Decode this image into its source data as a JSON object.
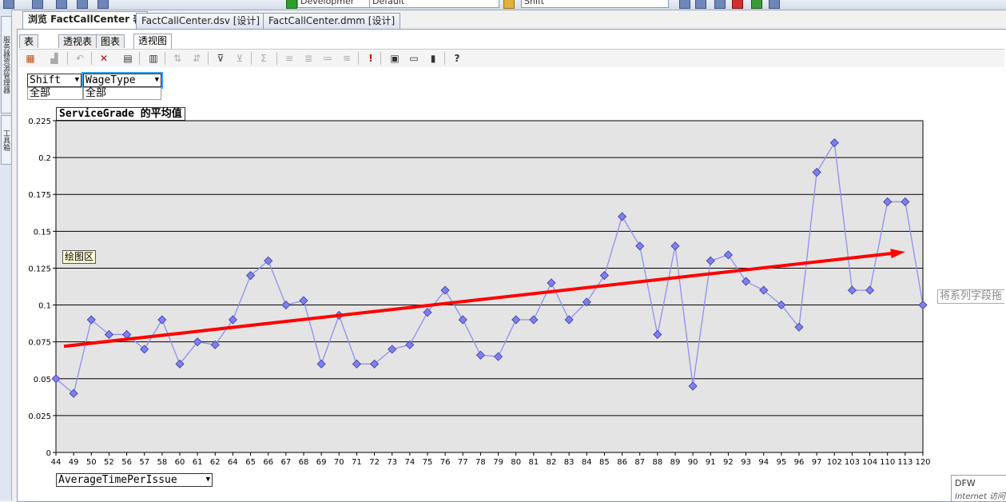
{
  "top_toolbar": {
    "combo1": "Developmer",
    "combo2": "Default",
    "combo3": "Shift"
  },
  "left_sidebar": {
    "tab1": "服务器资源管理器",
    "tab2": "工具箱"
  },
  "document_tabs": [
    {
      "label": "浏览 FactCallCenter 表",
      "active": true
    },
    {
      "label": "FactCallCenter.dsv [设计]",
      "active": false
    },
    {
      "label": "FactCallCenter.dmm [设计]",
      "active": false
    }
  ],
  "view_tabs": [
    {
      "label": "表",
      "active": false
    },
    {
      "label": "透视表",
      "active": false
    },
    {
      "label": "图表",
      "active": false
    },
    {
      "label": "透视图",
      "active": true
    }
  ],
  "filters": {
    "shift": {
      "label": "Shift",
      "value": "全部"
    },
    "wagetype": {
      "label": "WageType",
      "value": "全部"
    }
  },
  "chart": {
    "data_field": "ServiceGrade 的平均值",
    "plot_area_label": "绘图区",
    "series_drop_zone": "将系列字段拖",
    "category_field": "AverageTimePerIssue"
  },
  "popup": {
    "line1": "DFW",
    "line2": "Internet 访问"
  },
  "colors": {
    "series_line": "#8f8fef",
    "marker_fill": "#7f7fef",
    "trend_arrow": "#ff0000",
    "plot_bg": "#e4e4e4",
    "selection": "#36a3e6"
  },
  "chart_data": {
    "type": "line",
    "title": "ServiceGrade 的平均值",
    "xlabel": "AverageTimePerIssue",
    "ylabel": "",
    "ylim": [
      0,
      0.225
    ],
    "yticks": [
      "0",
      "0.025",
      "0.05",
      "0.075",
      "0.1",
      "0.125",
      "0.15",
      "0.175",
      "0.2",
      "0.225"
    ],
    "grid": true,
    "categories": [
      "44",
      "49",
      "50",
      "52",
      "56",
      "57",
      "58",
      "60",
      "61",
      "62",
      "64",
      "65",
      "66",
      "67",
      "68",
      "69",
      "70",
      "71",
      "72",
      "73",
      "74",
      "75",
      "76",
      "77",
      "78",
      "79",
      "80",
      "81",
      "82",
      "83",
      "84",
      "85",
      "86",
      "87",
      "88",
      "89",
      "90",
      "91",
      "92",
      "93",
      "94",
      "95",
      "96",
      "97",
      "102",
      "103",
      "104",
      "110",
      "113",
      "120"
    ],
    "series": [
      {
        "values": [
          0.05,
          0.04,
          0.09,
          0.08,
          0.08,
          0.07,
          0.09,
          0.06,
          0.075,
          0.073,
          0.09,
          0.12,
          0.13,
          0.1,
          0.103,
          0.06,
          0.093,
          0.06,
          0.06,
          0.07,
          0.073,
          0.095,
          0.11,
          0.09,
          0.066,
          0.065,
          0.09,
          0.09,
          0.115,
          0.09,
          0.102,
          0.12,
          0.16,
          0.14,
          0.08,
          0.14,
          0.045,
          0.13,
          0.134,
          0.116,
          0.11,
          0.1,
          0.085,
          0.19,
          0.21,
          0.11,
          0.11,
          0.17,
          0.17,
          0.1
        ]
      }
    ],
    "annotations": [
      {
        "type": "trend-arrow",
        "from": {
          "x": "44",
          "y": 0.072
        },
        "to": {
          "x": "113",
          "y": 0.136
        }
      }
    ]
  }
}
